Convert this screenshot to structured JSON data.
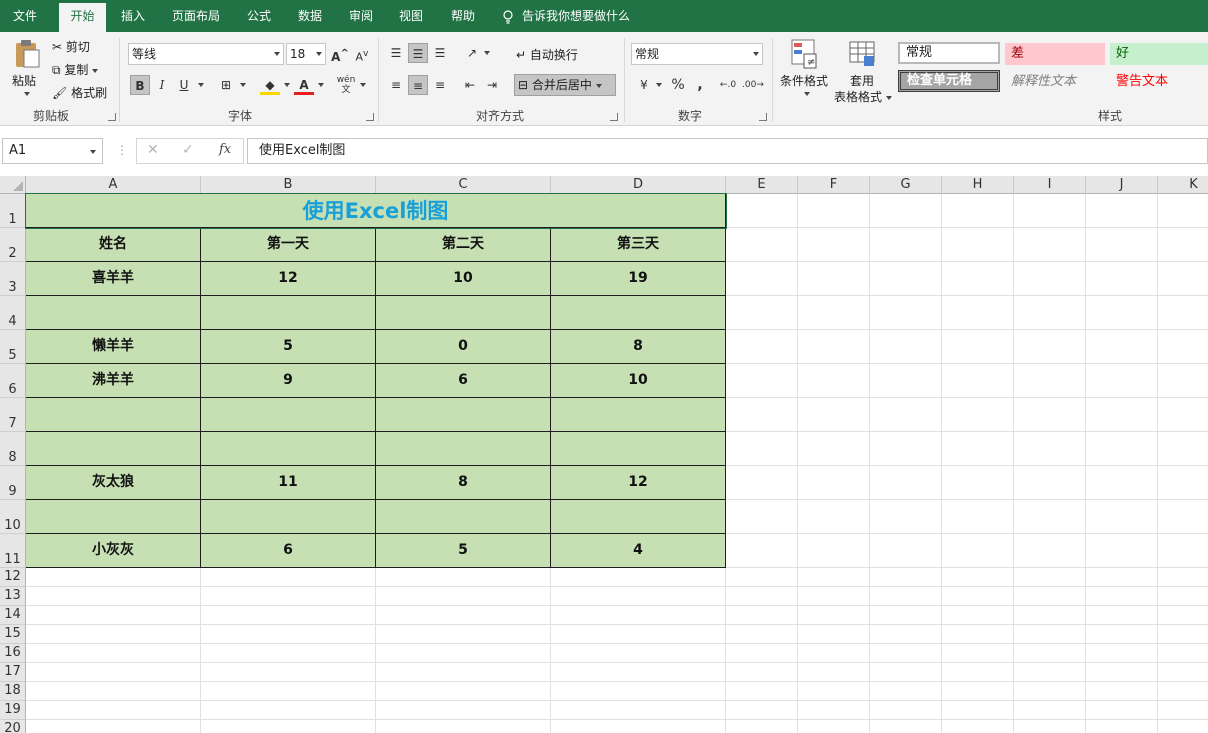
{
  "menu": {
    "items": [
      "文件",
      "开始",
      "插入",
      "页面布局",
      "公式",
      "数据",
      "审阅",
      "视图",
      "帮助"
    ],
    "tell_me": "告诉我你想要做什么"
  },
  "ribbon": {
    "clipboard": {
      "paste": "粘贴",
      "cut": "剪切",
      "copy": "复制",
      "format_painter": "格式刷",
      "group": "剪贴板"
    },
    "font": {
      "name": "等线",
      "size": "18",
      "group": "字体",
      "bold": "B",
      "italic": "I",
      "underline": "U",
      "grow": "A",
      "shrink": "A",
      "phonetic": "wén"
    },
    "alignment": {
      "wrap": "自动换行",
      "merge": "合并后居中",
      "group": "对齐方式"
    },
    "number": {
      "format": "常规",
      "percent": "%",
      "comma": ",",
      "group": "数字"
    },
    "styles": {
      "conditional": "条件格式",
      "table_format_1": "套用",
      "table_format_2": "表格格式",
      "normal": "常规",
      "bad": "差",
      "good": "好",
      "check_cell": "检查单元格",
      "explanatory": "解释性文本",
      "warning": "警告文本",
      "group": "样式"
    }
  },
  "formula_bar": {
    "name_box": "A1",
    "fx": "fx",
    "content": "使用Excel制图"
  },
  "columns": [
    "A",
    "B",
    "C",
    "D",
    "E",
    "F",
    "G",
    "H",
    "I",
    "J",
    "K"
  ],
  "rows": [
    "1",
    "2",
    "3",
    "4",
    "5",
    "6",
    "7",
    "8",
    "9",
    "10",
    "11",
    "12",
    "13",
    "14",
    "15",
    "16",
    "17",
    "18",
    "19",
    "20"
  ],
  "sheet": {
    "title": "使用Excel制图",
    "headers": [
      "姓名",
      "第一天",
      "第二天",
      "第三天"
    ],
    "data": [
      [
        "喜羊羊",
        "12",
        "10",
        "19"
      ],
      [
        "",
        "",
        "",
        ""
      ],
      [
        "懒羊羊",
        "5",
        "0",
        "8"
      ],
      [
        "沸羊羊",
        "9",
        "6",
        "10"
      ],
      [
        "",
        "",
        "",
        ""
      ],
      [
        "",
        "",
        "",
        ""
      ],
      [
        "灰太狼",
        "11",
        "8",
        "12"
      ],
      [
        "",
        "",
        "",
        ""
      ],
      [
        "小灰灰",
        "6",
        "5",
        "4"
      ]
    ]
  },
  "colors": {
    "brand": "#217346",
    "cell_fill": "#c6e0b4",
    "title_text": "#1aa0d8"
  }
}
